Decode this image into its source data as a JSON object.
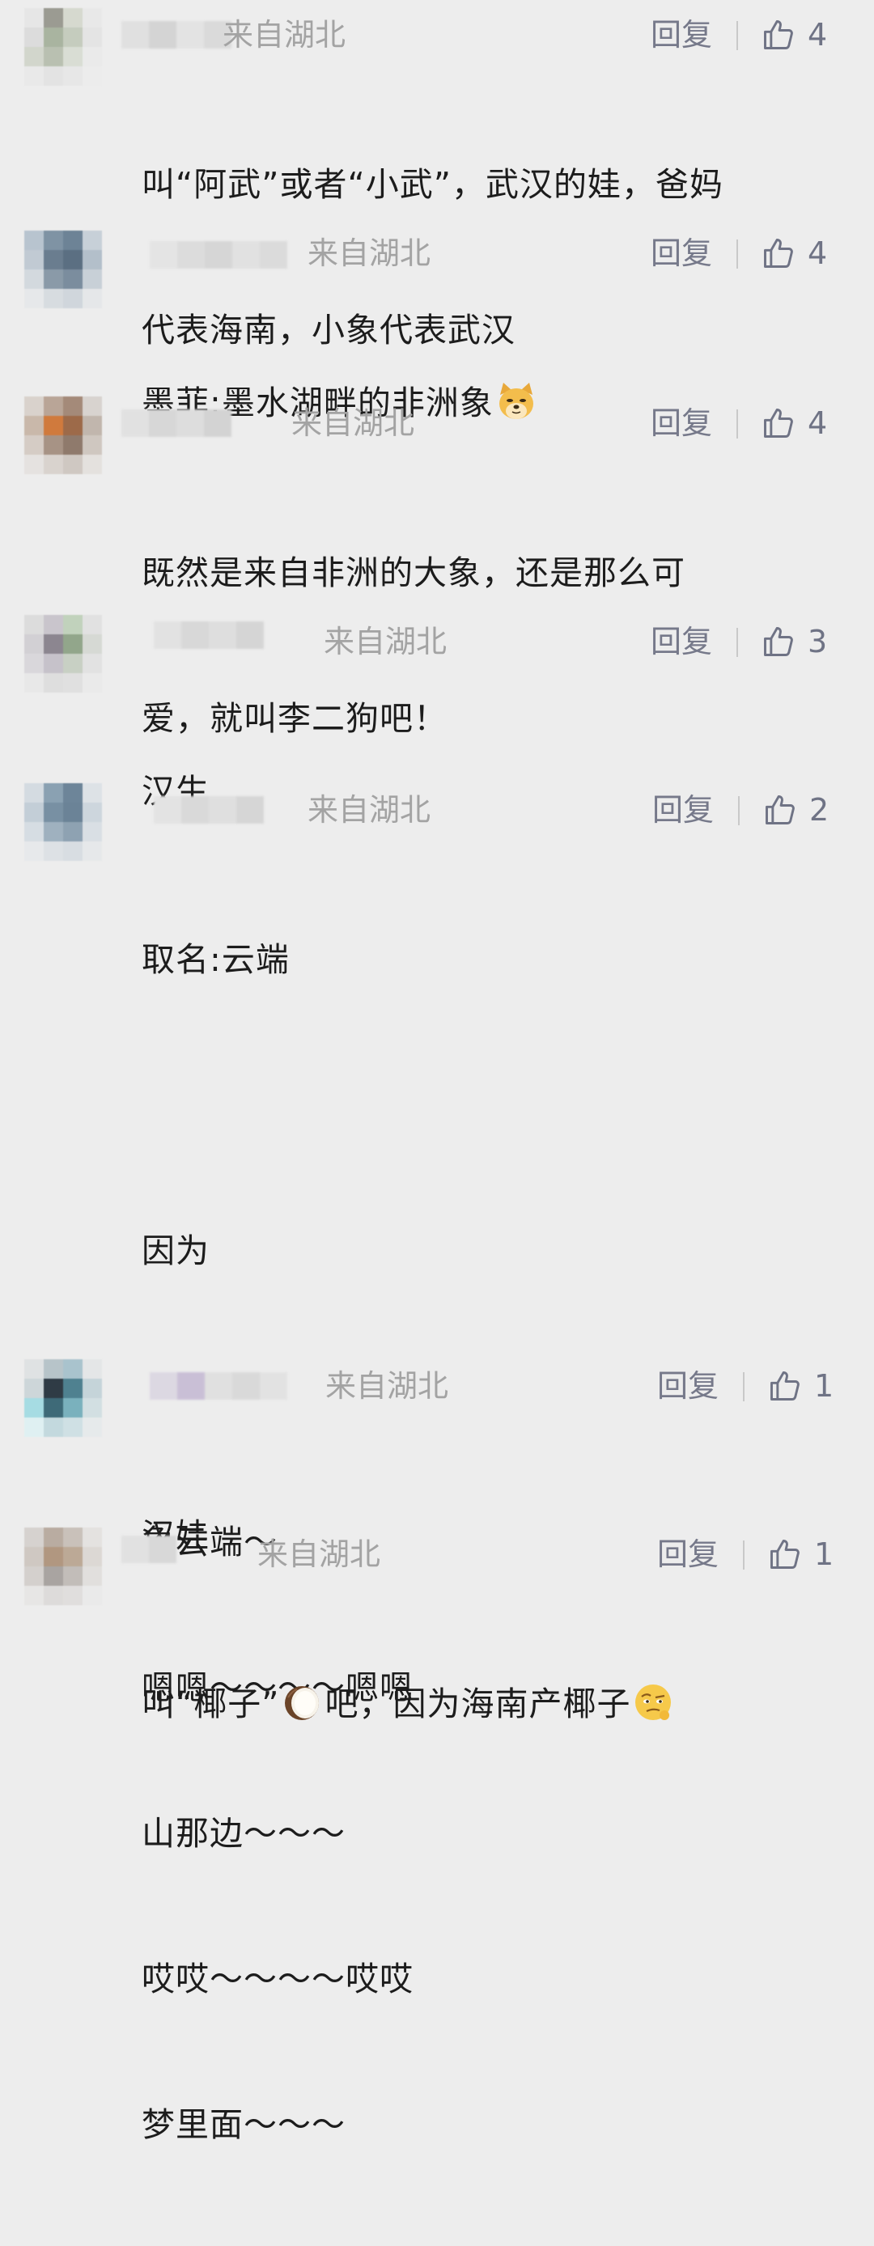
{
  "icons": {
    "like": "thumbs-up-outline-icon",
    "doge": "doge-emoji-icon",
    "coconut": "coconut-emoji-icon",
    "smirk": "skeptical-face-emoji-icon"
  },
  "colors": {
    "background": "#ededed",
    "location": "#a3a3a3",
    "reply": "#76798a",
    "text": "#1c1c1c"
  },
  "comments": [
    {
      "location": "来自湖北",
      "reply": "回复",
      "likes": "4",
      "lines": [
        "叫“阿武”或者“小武”，武汉的娃，爸妈",
        "代表海南，小象代表武汉"
      ]
    },
    {
      "location": "来自湖北",
      "reply": "回复",
      "likes": "4",
      "text_before": "墨菲:墨水湖畔的非洲象"
    },
    {
      "location": "来自湖北",
      "reply": "回复",
      "likes": "4",
      "lines": [
        "既然是来自非洲的大象，还是那么可",
        "爱，就叫李二狗吧！"
      ]
    },
    {
      "location": "来自湖北",
      "reply": "回复",
      "likes": "3",
      "lines": [
        "汉生"
      ]
    },
    {
      "location": "来自湖北",
      "reply": "回复",
      "likes": "2",
      "lines": [
        "取名:云端",
        "",
        "因为",
        "",
        "象云端～",
        "嗯嗯～～～～嗯嗯",
        "山那边～～～",
        "哎哎～～～～哎哎",
        "梦里面～～～"
      ]
    },
    {
      "location": "来自湖北",
      "reply": "回复",
      "likes": "1",
      "lines": [
        "汉娃"
      ]
    },
    {
      "location": "来自湖北",
      "reply": "回复",
      "likes": "1",
      "text_part1": "叫“椰子”",
      "text_part2": "吧，因为海南产椰子"
    }
  ]
}
